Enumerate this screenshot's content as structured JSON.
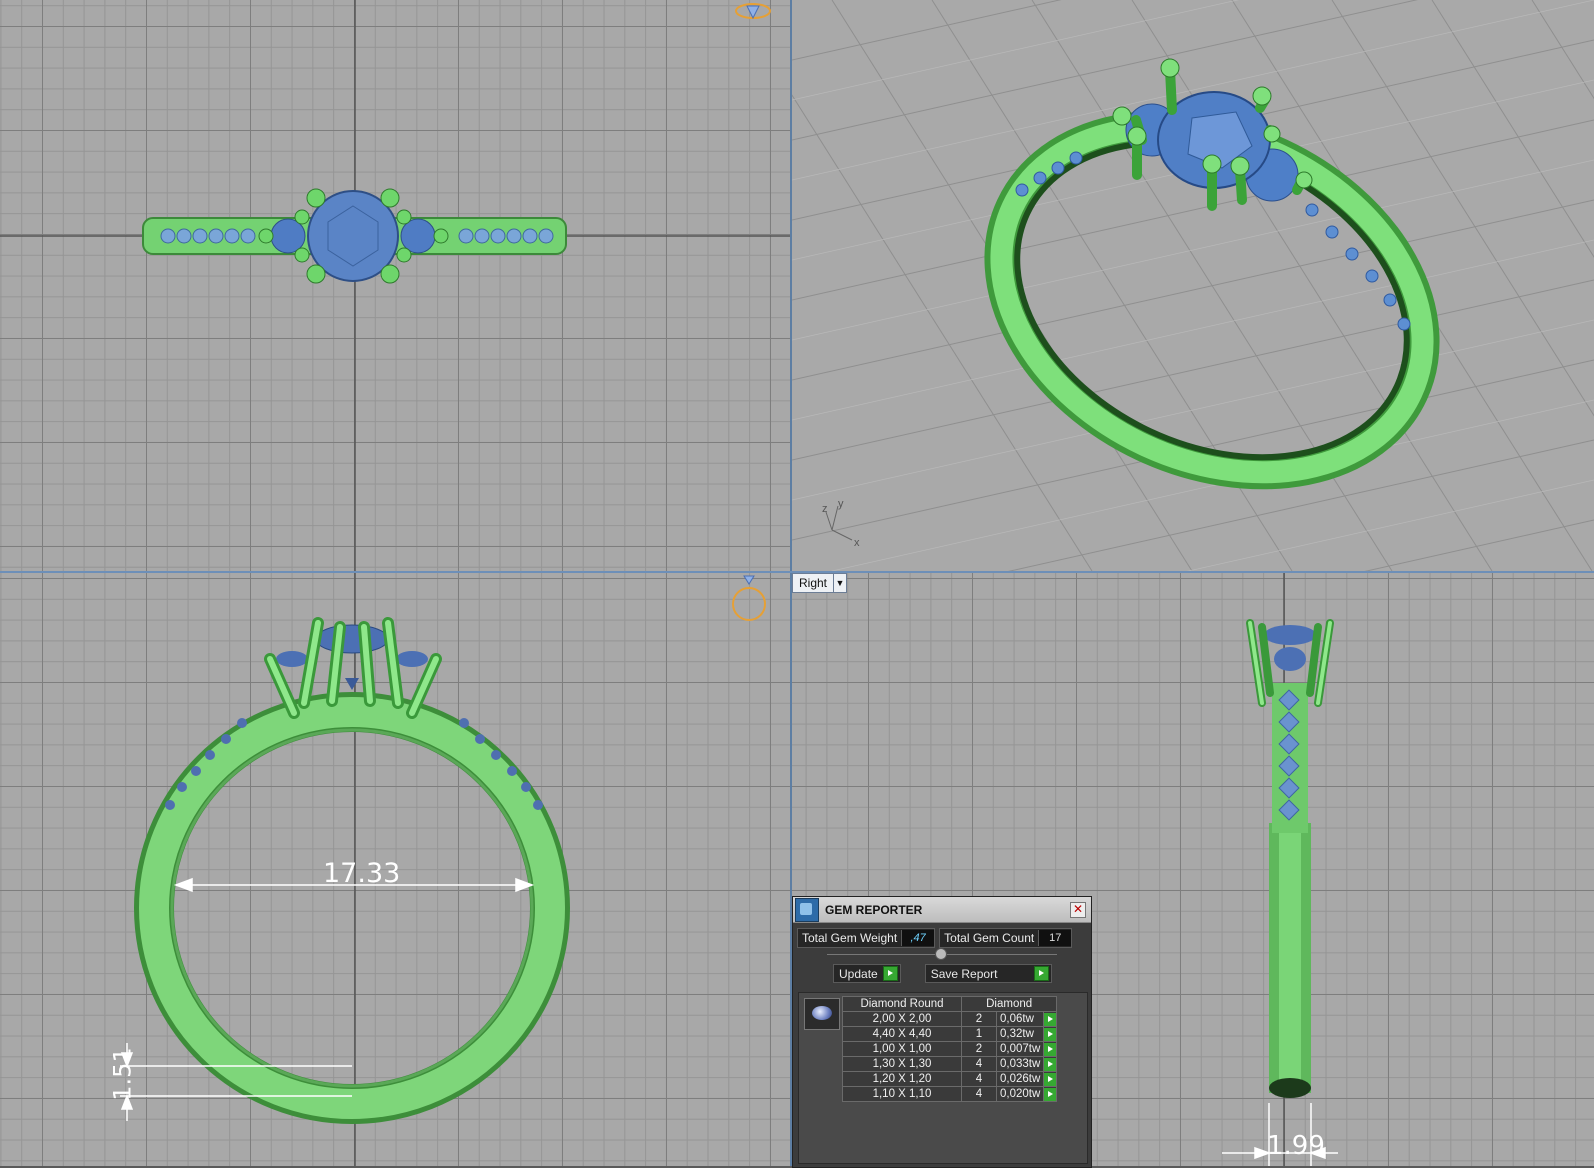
{
  "viewports": {
    "front_dimension_width": "17.33",
    "front_dimension_height": "1.51",
    "right_dimension_width": "1.99",
    "persp_axis_x": "x",
    "persp_axis_y": "y",
    "persp_axis_z": "z",
    "right_view_label": "Right",
    "right_view_arrow": "▼"
  },
  "colors": {
    "metal": "#7dd87a",
    "gem": "#4c79c6",
    "grid_bg": "#a8a8a8",
    "orientation_ring": "#e8a030"
  },
  "gem_reporter": {
    "title": "GEM REPORTER",
    "close": "✕",
    "total_weight_label": "Total Gem Weight",
    "total_weight_value": ",47",
    "total_count_label": "Total Gem Count",
    "total_count_value": "17",
    "update_label": "Update",
    "save_label": "Save Report",
    "table": {
      "col_shape": "Diamond Round",
      "col_material": "Diamond",
      "rows": [
        {
          "size": "2,00 X 2,00",
          "qty": "2",
          "weight": "0,06tw"
        },
        {
          "size": "4,40 X 4,40",
          "qty": "1",
          "weight": "0,32tw"
        },
        {
          "size": "1,00 X 1,00",
          "qty": "2",
          "weight": "0,007tw"
        },
        {
          "size": "1,30 X 1,30",
          "qty": "4",
          "weight": "0,033tw"
        },
        {
          "size": "1,20 X 1,20",
          "qty": "4",
          "weight": "0,026tw"
        },
        {
          "size": "1,10 X 1,10",
          "qty": "4",
          "weight": "0,020tw"
        }
      ]
    }
  }
}
